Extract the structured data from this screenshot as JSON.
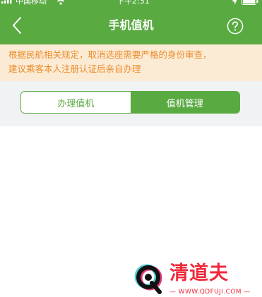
{
  "status_bar": {
    "carrier": "中国移动",
    "time": "下午2:31",
    "signal_icon": "cellular-signal-icon",
    "wifi_icon": "wifi-icon",
    "location_icon": "location-arrow-icon",
    "battery_icon": "battery-icon"
  },
  "nav": {
    "title": "手机值机",
    "back_icon": "chevron-left-icon",
    "help_icon": "question-circle-icon"
  },
  "notice": {
    "line1": "根据民航相关规定，取消选座需要严格的身份审查，",
    "line2": "建议乘客本人注册认证后亲自办理"
  },
  "segmented_control": {
    "options": [
      {
        "label": "办理值机",
        "selected": false
      },
      {
        "label": "值机管理",
        "selected": true
      }
    ]
  },
  "watermark": {
    "title": "清道夫",
    "url": "— WWW.QDFUJI.COM —"
  },
  "colors": {
    "primary_green": "#5aaa42",
    "notice_background": "#fcebd4",
    "notice_text": "#e98d2e",
    "watermark_red": "#ee2a3c"
  }
}
